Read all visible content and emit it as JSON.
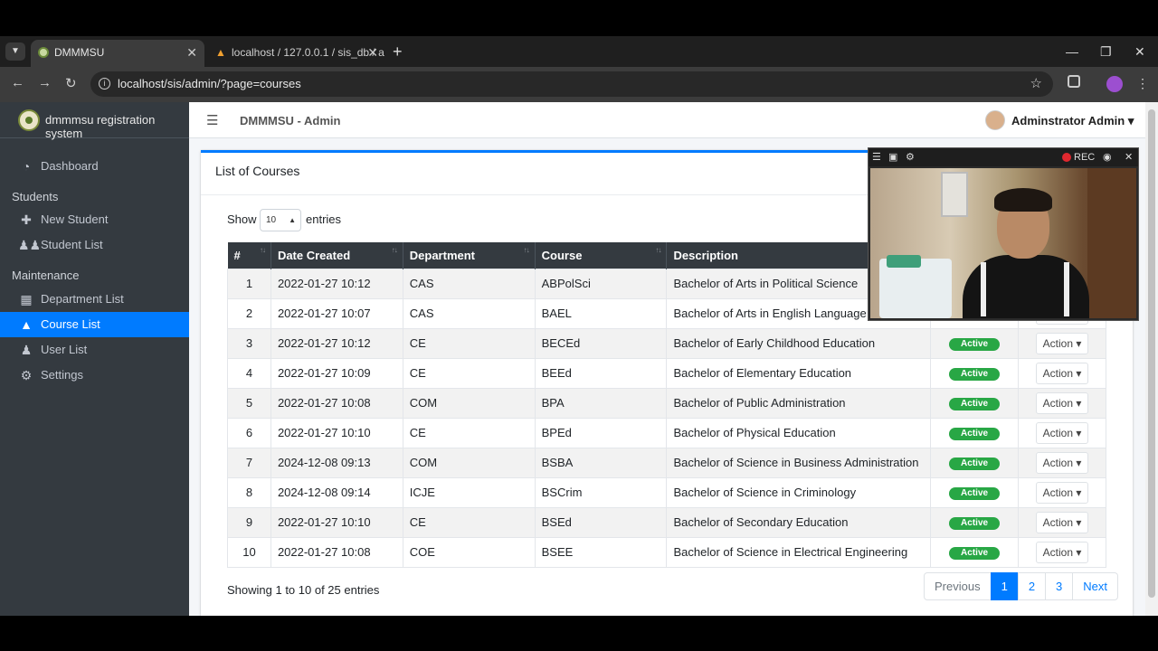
{
  "browser": {
    "tabs": [
      {
        "title": "DMMMSU",
        "active": true
      },
      {
        "title": "localhost / 127.0.0.1 / sis_db / a",
        "active": false
      }
    ],
    "url": "localhost/sis/admin/?page=courses"
  },
  "app": {
    "brand": "dmmmsu registration system",
    "title": "DMMMSU - Admin",
    "user": "Adminstrator Admin"
  },
  "sidebar": {
    "dashboard": "Dashboard",
    "students_header": "Students",
    "new_student": "New Student",
    "student_list": "Student List",
    "maintenance_header": "Maintenance",
    "department_list": "Department List",
    "course_list": "Course List",
    "user_list": "User List",
    "settings": "Settings"
  },
  "card": {
    "title": "List of Courses",
    "show_label": "Show",
    "page_size": "10",
    "entries_label": "entries",
    "info": "Showing 1 to 10 of 25 entries"
  },
  "table": {
    "headers": [
      "#",
      "Date Created",
      "Department",
      "Course",
      "Description"
    ],
    "status_label": "Active",
    "action_label": "Action",
    "rows": [
      {
        "n": "1",
        "date": "2022-01-27 10:12",
        "dept": "CAS",
        "course": "ABPolSci",
        "desc": "Bachelor of Arts in Political Science"
      },
      {
        "n": "2",
        "date": "2022-01-27 10:07",
        "dept": "CAS",
        "course": "BAEL",
        "desc": "Bachelor of Arts in English Language"
      },
      {
        "n": "3",
        "date": "2022-01-27 10:12",
        "dept": "CE",
        "course": "BECEd",
        "desc": "Bachelor of Early Childhood Education"
      },
      {
        "n": "4",
        "date": "2022-01-27 10:09",
        "dept": "CE",
        "course": "BEEd",
        "desc": "Bachelor of Elementary Education"
      },
      {
        "n": "5",
        "date": "2022-01-27 10:08",
        "dept": "COM",
        "course": "BPA",
        "desc": "Bachelor of Public Administration"
      },
      {
        "n": "6",
        "date": "2022-01-27 10:10",
        "dept": "CE",
        "course": "BPEd",
        "desc": "Bachelor of Physical Education"
      },
      {
        "n": "7",
        "date": "2024-12-08 09:13",
        "dept": "COM",
        "course": "BSBA",
        "desc": "Bachelor of Science in Business Administration"
      },
      {
        "n": "8",
        "date": "2024-12-08 09:14",
        "dept": "ICJE",
        "course": "BSCrim",
        "desc": "Bachelor of Science in Criminology"
      },
      {
        "n": "9",
        "date": "2022-01-27 10:10",
        "dept": "CE",
        "course": "BSEd",
        "desc": "Bachelor of Secondary Education"
      },
      {
        "n": "10",
        "date": "2022-01-27 10:08",
        "dept": "COE",
        "course": "BSEE",
        "desc": "Bachelor of Science in Electrical Engineering"
      }
    ]
  },
  "pagination": {
    "previous": "Previous",
    "pages": [
      "1",
      "2",
      "3"
    ],
    "next": "Next"
  },
  "overlay": {
    "rec_label": "REC"
  },
  "colors": {
    "primary": "#007bff",
    "sidebar": "#343a40",
    "success": "#28a745"
  }
}
